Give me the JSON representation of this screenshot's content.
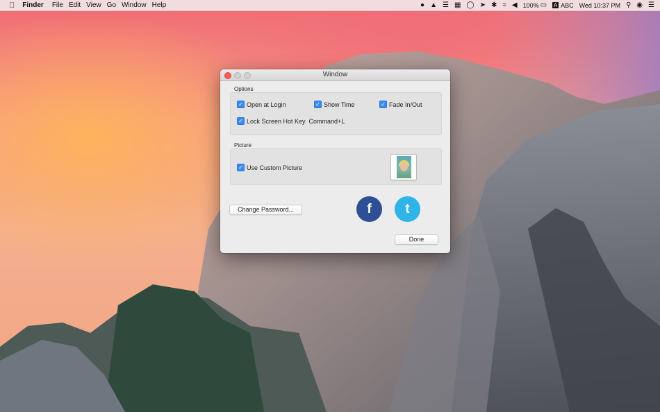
{
  "menubar": {
    "app_name": "Finder",
    "menus": [
      "File",
      "Edit",
      "View",
      "Go",
      "Window",
      "Help"
    ],
    "battery": "100%",
    "input_source": "ABC",
    "clock": "Wed 10:37 PM"
  },
  "window": {
    "title": "Window",
    "options": {
      "label": "Options",
      "open_at_login": {
        "label": "Open at Login",
        "checked": true
      },
      "show_time": {
        "label": "Show Time",
        "checked": true
      },
      "fade": {
        "label": "Fade In/Out",
        "checked": true
      },
      "lock_hotkey": {
        "label": "Lock Screen Hot Key",
        "checked": true,
        "shortcut": "Command+L"
      }
    },
    "picture": {
      "label": "Picture",
      "use_custom": {
        "label": "Use Custom Picture",
        "checked": true
      }
    },
    "change_password_label": "Change Password...",
    "facebook_glyph": "f",
    "twitter_glyph": "t",
    "done_label": "Done"
  },
  "colors": {
    "checkbox": "#3a8cf0",
    "facebook": "#2e4f94",
    "twitter": "#2fb4e8",
    "close_light": "#fc5f57"
  }
}
